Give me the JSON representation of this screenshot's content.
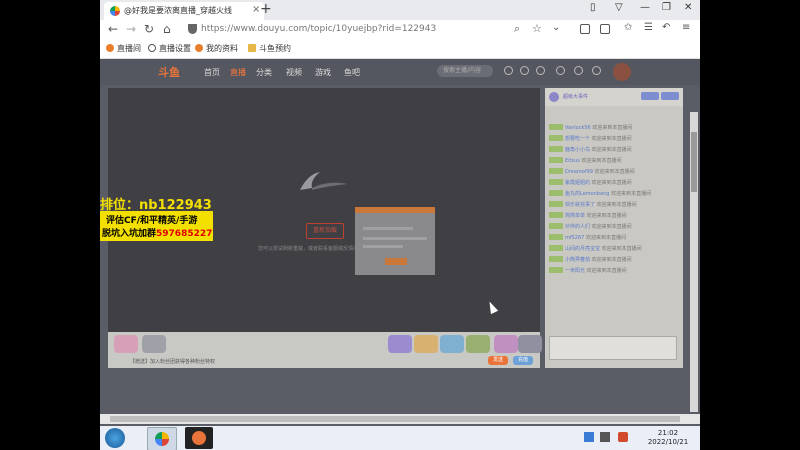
{
  "browser": {
    "tab_title": "@好我是要浓离直播_穿越火线",
    "url": "https://www.douyu.com/topic/10yuejbp?rid=122943",
    "bookmarks": [
      "直播间",
      "直播设置",
      "我的资料",
      "斗鱼预约"
    ]
  },
  "site": {
    "logo": "斗鱼",
    "nav": [
      "首页",
      "直播",
      "分类",
      "视频",
      "游戏",
      "鱼吧"
    ],
    "search_placeholder": "搜索主播/内容"
  },
  "player": {
    "button": "重新加载",
    "message": "您可以尝试刷新重载，或者联系客服或反馈问题",
    "gift_hint": "【赠送】加入粉丝团获得各种粉丝特权",
    "send": "发送",
    "recharge": "充值"
  },
  "chat": {
    "title": "超级大事件",
    "messages": [
      {
        "user": "Vanlock56",
        "msg": "欢迎来到本直播间"
      },
      {
        "user": "想要吃一个",
        "msg": "欢迎来到本直播间"
      },
      {
        "user": "鹿角小小鸟",
        "msg": "欢迎来到本直播间"
      },
      {
        "user": "Eitsus",
        "msg": "欢迎来到本直播间"
      },
      {
        "user": "Dreamof99",
        "msg": "欢迎来到本直播间"
      },
      {
        "user": "紫霞姐姐的",
        "msg": "欢迎来到本直播间"
      },
      {
        "user": "鱼丸的Lemonbang",
        "msg": "欢迎来到本直播间"
      },
      {
        "user": "快乐就完事了",
        "msg": "欢迎来到本直播间"
      },
      {
        "user": "简简单单",
        "msg": "欢迎来到本直播间"
      },
      {
        "user": "伙伴的人们",
        "msg": "欢迎来到本直播间"
      },
      {
        "user": "mf5267",
        "msg": "欢迎来到本直播间"
      },
      {
        "user": "山间的月亮宝宝",
        "msg": "欢迎来到本直播间"
      },
      {
        "user": "小熊弄蕃茄",
        "msg": "欢迎来到本直播间"
      },
      {
        "user": "一米阳光",
        "msg": "欢迎来到本直播间"
      }
    ]
  },
  "ad": {
    "title": "排位：nb122943",
    "line1": "评估CF/和平精英/手游",
    "line2_prefix": "脱坑入坑加群",
    "line2_num": "597685227"
  },
  "clock": {
    "time": "21:02",
    "date": "2022/10/21"
  },
  "colors": {
    "ad_yellow": "#f4e000",
    "accent_orange": "#e8743a"
  }
}
